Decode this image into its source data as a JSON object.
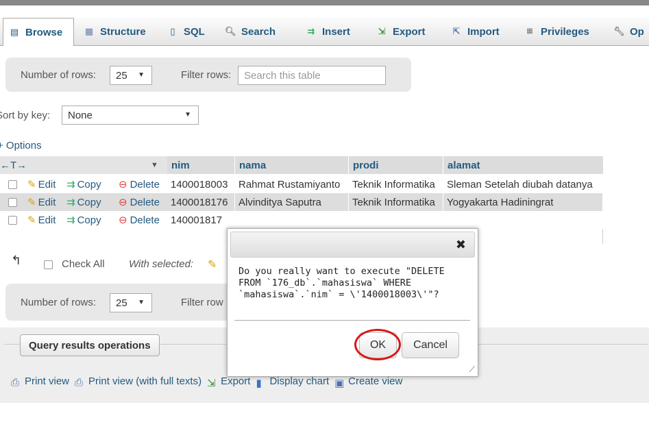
{
  "tabs": [
    {
      "label": "Browse",
      "icon": "browse-icon",
      "active": true
    },
    {
      "label": "Structure",
      "icon": "structure-icon"
    },
    {
      "label": "SQL",
      "icon": "sql-icon"
    },
    {
      "label": "Search",
      "icon": "search-icon"
    },
    {
      "label": "Insert",
      "icon": "insert-icon"
    },
    {
      "label": "Export",
      "icon": "export-icon"
    },
    {
      "label": "Import",
      "icon": "import-icon"
    },
    {
      "label": "Privileges",
      "icon": "privileges-icon"
    },
    {
      "label": "Op",
      "icon": "operations-icon"
    }
  ],
  "nav_top": {
    "rows_label": "Number of rows:",
    "rows_value": "25",
    "filter_label": "Filter rows:",
    "filter_placeholder": "Search this table"
  },
  "sort": {
    "label": "Sort by key:",
    "value": "None"
  },
  "options_label": "+ Options",
  "table": {
    "arrows": "←T→",
    "columns": [
      "nim",
      "nama",
      "prodi",
      "alamat"
    ],
    "action_labels": {
      "edit": "Edit",
      "copy": "Copy",
      "delete": "Delete"
    },
    "rows": [
      {
        "nim": "1400018003",
        "nama": "Rahmat Rustamiyanto",
        "prodi": "Teknik Informatika",
        "alamat": "Sleman Setelah diubah datanya"
      },
      {
        "nim": "1400018176",
        "nama": "Alvinditya Saputra",
        "prodi": "Teknik Informatika",
        "alamat": "Yogyakarta Hadiningrat"
      },
      {
        "nim": "140001817",
        "nama": "",
        "prodi": "",
        "alamat": ""
      }
    ]
  },
  "bulk": {
    "check_all": "Check All",
    "with_selected": "With selected:"
  },
  "nav_bottom": {
    "rows_label": "Number of rows:",
    "rows_value": "25",
    "filter_label": "Filter row"
  },
  "ops": {
    "title": "Query results operations",
    "links": [
      "Print view",
      "Print view (with full texts)",
      "Export",
      "Display chart",
      "Create view"
    ]
  },
  "dialog": {
    "close": "✖",
    "message": "Do you really want to execute \"DELETE\nFROM `176_db`.`mahasiswa` WHERE\n`mahasiswa`.`nim` = \\'1400018003\\'\"?",
    "ok": "OK",
    "cancel": "Cancel"
  },
  "colors": {
    "link": "#235a81",
    "highlight_ring": "#d8161b",
    "row_alt": "#dddddd"
  }
}
